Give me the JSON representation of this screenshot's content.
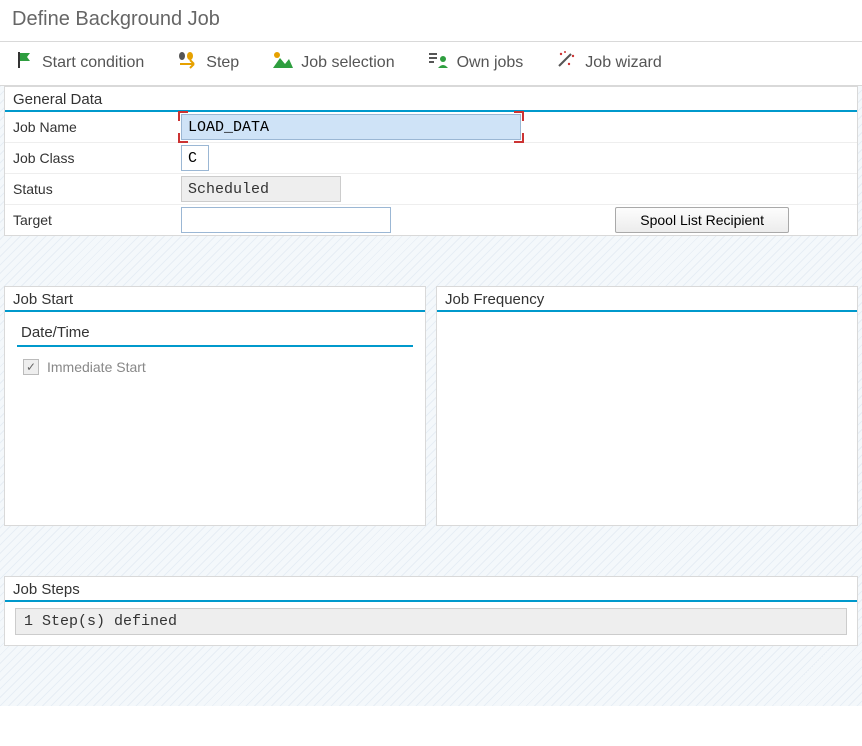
{
  "page": {
    "title": "Define Background Job"
  },
  "toolbar": {
    "start_condition": "Start condition",
    "step": "Step",
    "job_selection": "Job selection",
    "own_jobs": "Own jobs",
    "job_wizard": "Job wizard"
  },
  "general": {
    "section_title": "General Data",
    "labels": {
      "job_name": "Job Name",
      "job_class": "Job Class",
      "status": "Status",
      "target": "Target"
    },
    "values": {
      "job_name": "LOAD_DATA",
      "job_class": "C",
      "status": "Scheduled",
      "target": ""
    },
    "spool_button": "Spool List Recipient"
  },
  "job_start": {
    "section_title": "Job Start",
    "datetime_title": "Date/Time",
    "immediate_label": "Immediate Start",
    "immediate_checked": true
  },
  "job_freq": {
    "section_title": "Job Frequency"
  },
  "job_steps": {
    "section_title": "Job Steps",
    "readout": "1 Step(s) defined"
  }
}
